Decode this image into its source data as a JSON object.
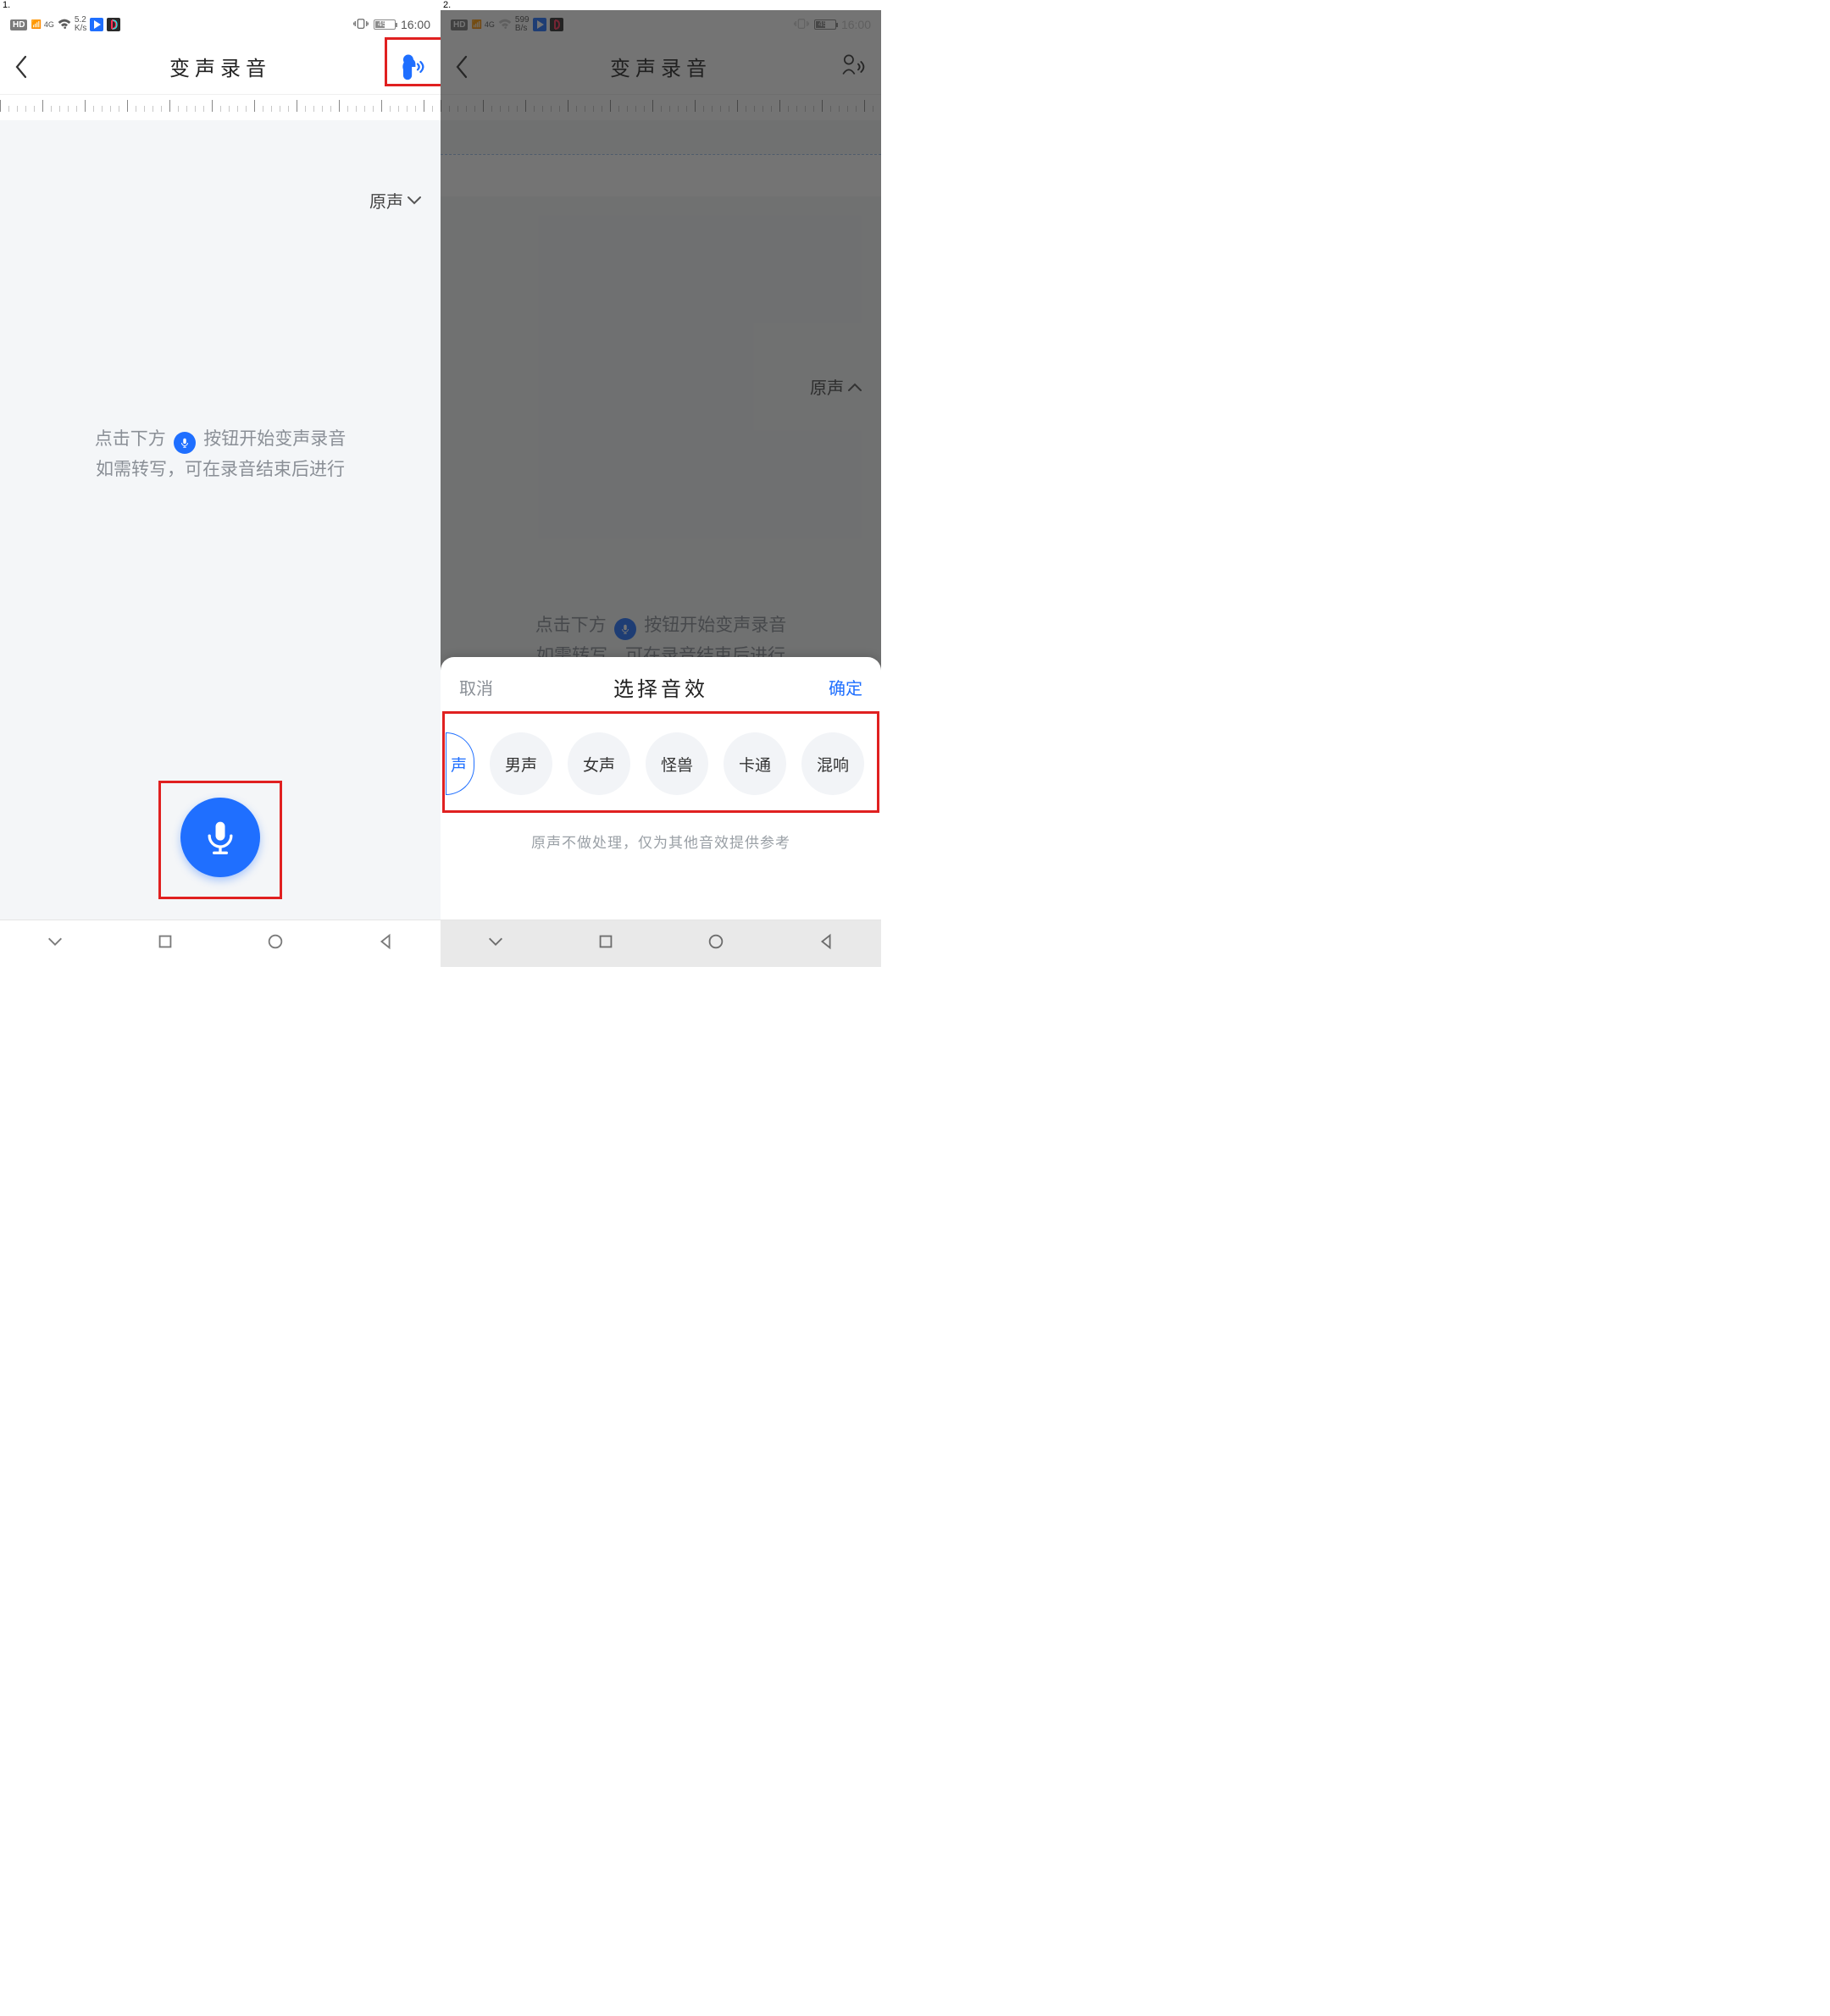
{
  "steps": {
    "one": "1.",
    "two": "2."
  },
  "status": {
    "hd": "HD",
    "net": "4G",
    "speed1_top": "5.2",
    "speed1_bot": "K/s",
    "speed2_top": "599",
    "speed2_bot": "B/s",
    "batt_pct": "45",
    "time": "16:00"
  },
  "title": "变声录音",
  "voice_type": "原声",
  "hint": {
    "part1": "点击下方",
    "part2": "按钮开始变声录音",
    "line2": "如需转写，可在录音结束后进行"
  },
  "sheet": {
    "cancel": "取消",
    "title": "选择音效",
    "confirm": "确定",
    "chips": [
      "声",
      "男声",
      "女声",
      "怪兽",
      "卡通",
      "混响"
    ],
    "note": "原声不做处理，仅为其他音效提供参考"
  }
}
